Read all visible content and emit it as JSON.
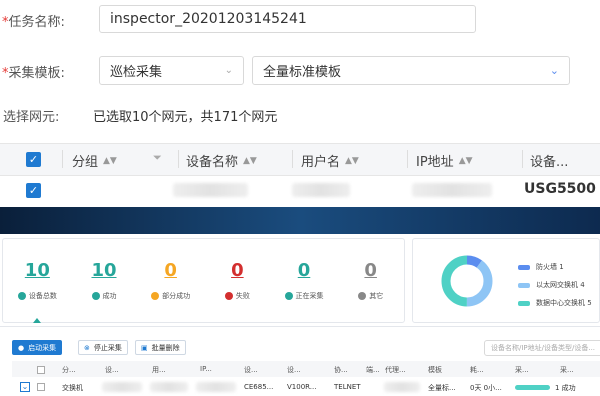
{
  "form": {
    "task_label": "任务名称:",
    "task_value": "inspector_20201203145241",
    "template_label": "采集模板:",
    "template_type": "巡检采集",
    "template_value": "全量标准模板",
    "ne_label": "选择网元:",
    "ne_summary": "已选取10个网元，共171个网元"
  },
  "ne_table": {
    "columns": [
      "分组",
      "设备名称",
      "用户名",
      "IP地址",
      "设备..."
    ],
    "row_type": "USG5500"
  },
  "stats": [
    {
      "value": "10",
      "label": "设备总数",
      "color": "#26a69a"
    },
    {
      "value": "10",
      "label": "成功",
      "color": "#26a69a"
    },
    {
      "value": "0",
      "label": "部分成功",
      "color": "#f5a623"
    },
    {
      "value": "0",
      "label": "失败",
      "color": "#d32f2f"
    },
    {
      "value": "0",
      "label": "正在采集",
      "color": "#26a69a"
    },
    {
      "value": "0",
      "label": "其它",
      "color": "#888888"
    }
  ],
  "donut_legend": [
    {
      "label": "防火墙 1",
      "color": "#5b8def"
    },
    {
      "label": "以太网交换机 4",
      "color": "#8ec5f5"
    },
    {
      "label": "数据中心交换机 5",
      "color": "#4fd1c5"
    }
  ],
  "donut_values": [
    1,
    4,
    5
  ],
  "toolbar": {
    "start": "启动采集",
    "stop": "停止采集",
    "delete": "批量删除",
    "search_placeholder": "设备名称/IP地址/设备类型/设备..."
  },
  "result_table": {
    "columns": [
      "分...",
      "设...",
      "用...",
      "IP...",
      "设...",
      "设...",
      "协...",
      "端...",
      "代理...",
      "模板",
      "耗...",
      "采...",
      "采..."
    ],
    "row": {
      "group": "交换机",
      "type": "CE685...",
      "model": "V100R...",
      "protocol": "TELNET",
      "template": "全量标...",
      "duration": "0天 0小...",
      "result": "1 成功"
    }
  }
}
